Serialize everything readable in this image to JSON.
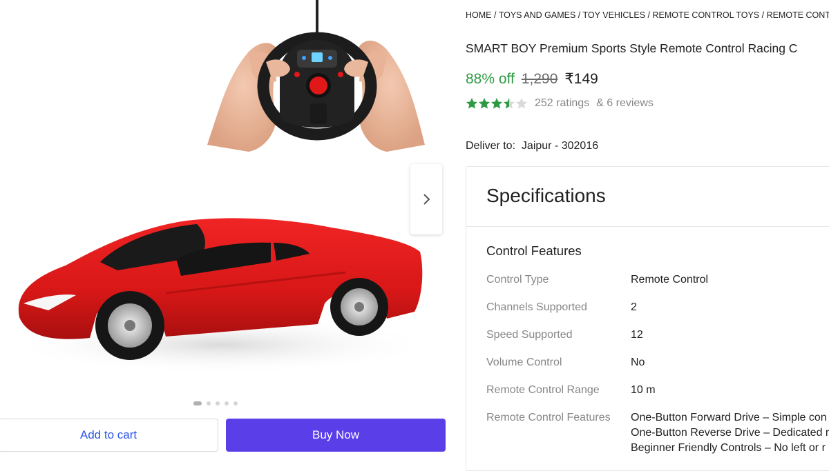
{
  "breadcrumb": [
    "HOME",
    "TOYS AND GAMES",
    "TOY VEHICLES",
    "REMOTE CONTROL TOYS",
    "REMOTE CONTROL T"
  ],
  "product": {
    "title": "SMART BOY Premium Sports Style Remote Control Racing C",
    "discount": "88% off",
    "mrp": "1,290",
    "price": "₹149",
    "rating_value": 3.5,
    "ratings_text": "252 ratings",
    "reviews_text": "& 6 reviews"
  },
  "delivery": {
    "label": "Deliver to:",
    "location": "Jaipur - 302016"
  },
  "gallery": {
    "image_count": 5,
    "active_index": 0
  },
  "actions": {
    "add_to_cart": "Add to cart",
    "buy_now": "Buy Now"
  },
  "specifications": {
    "heading": "Specifications",
    "group": "Control Features",
    "rows": [
      {
        "key": "Control Type",
        "value": "Remote Control"
      },
      {
        "key": "Channels Supported",
        "value": "2"
      },
      {
        "key": "Speed Supported",
        "value": "12"
      },
      {
        "key": "Volume Control",
        "value": "No"
      },
      {
        "key": "Remote Control Range",
        "value": "10 m"
      },
      {
        "key": "Remote Control Features",
        "value_lines": [
          "One-Button Forward Drive – Simple con",
          "One-Button Reverse Drive – Dedicated r",
          "Beginner Friendly Controls – No left or r"
        ]
      }
    ]
  },
  "colors": {
    "discount": "#2e9a44",
    "star": "#2e9a44",
    "buy_button": "#5a3fe8",
    "cart_text": "#2a55e5",
    "car_body": "#e31b1b"
  },
  "icons": {
    "next": "chevron-right-icon",
    "star": "star-icon"
  }
}
